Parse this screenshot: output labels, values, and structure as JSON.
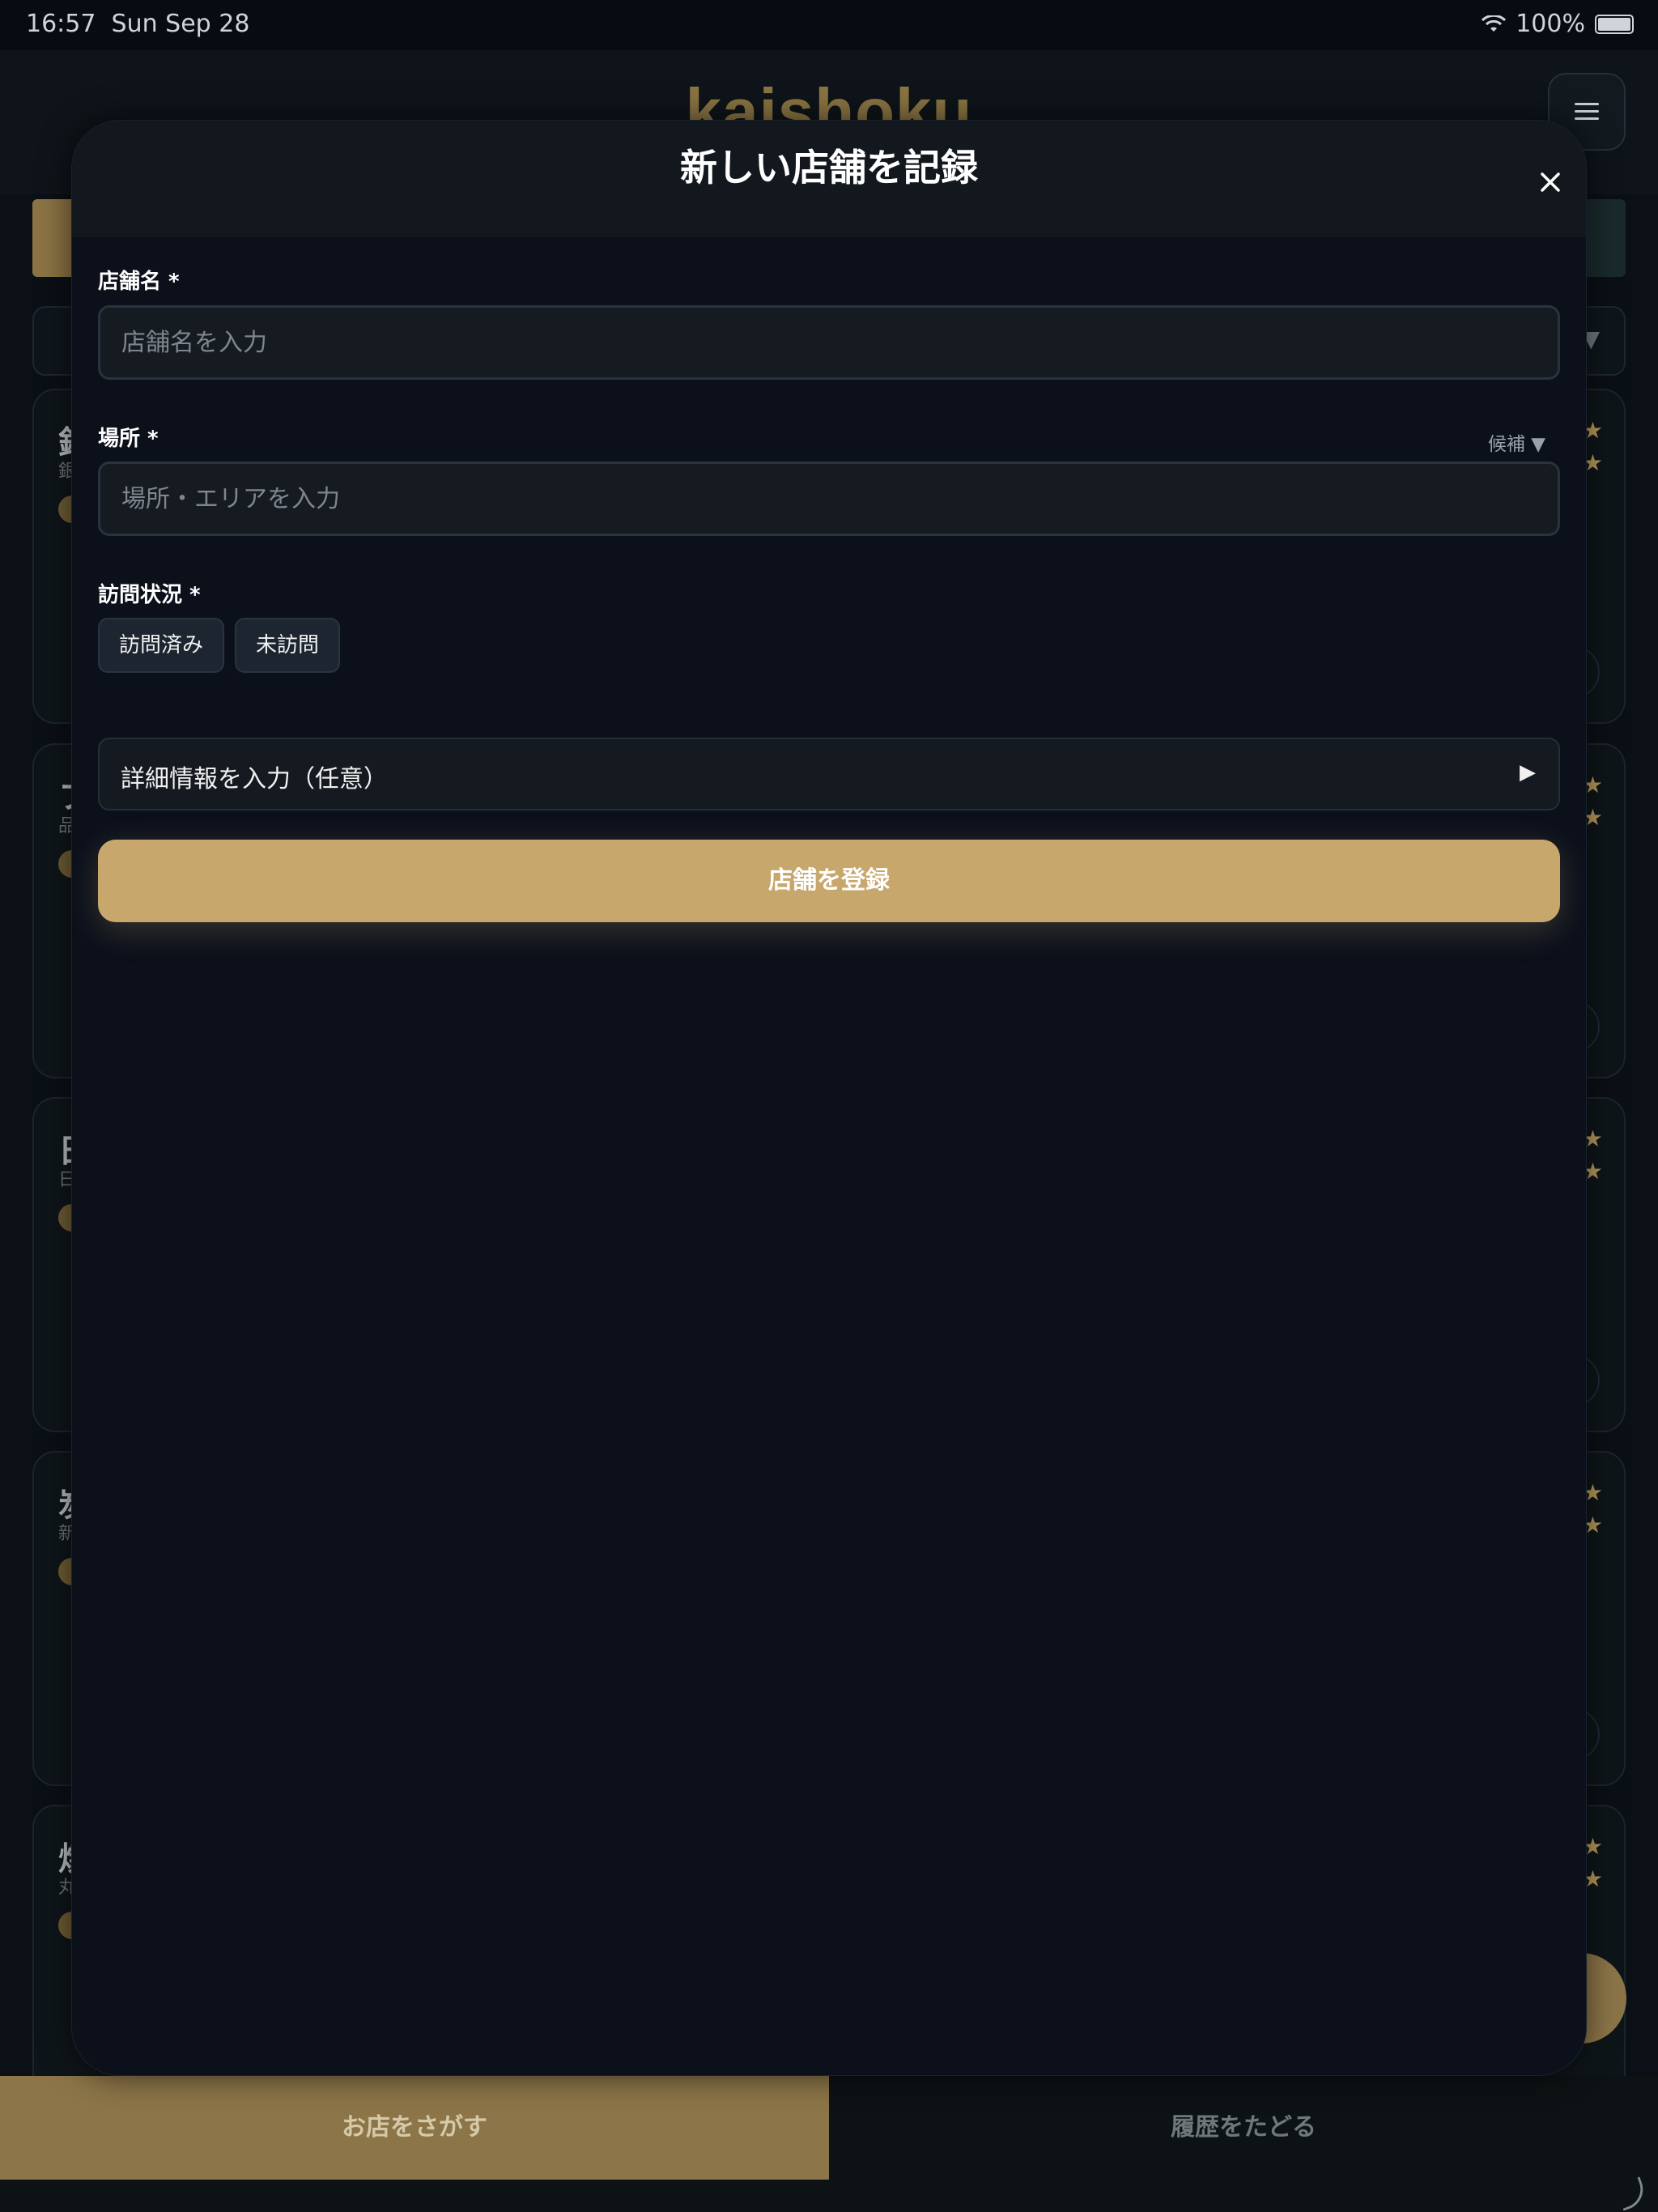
{
  "status_bar": {
    "time": "16:57",
    "date": "Sun Sep 28",
    "battery": "100%"
  },
  "app": {
    "brand": "kaishoku"
  },
  "background_cards": [
    {
      "title": "銀",
      "sub": "銀"
    },
    {
      "title": "フ",
      "sub": "品"
    },
    {
      "title": "日",
      "sub": "日"
    },
    {
      "title": "炭",
      "sub": "新"
    },
    {
      "title": "焼",
      "sub": "丸"
    }
  ],
  "bottom_nav": {
    "search_label": "お店をさがす",
    "history_label": "履歴をたどる"
  },
  "modal": {
    "title": "新しい店舗を記録",
    "store_name": {
      "label": "店舗名 *",
      "placeholder": "店舗名を入力",
      "value": ""
    },
    "location": {
      "label": "場所 *",
      "hint": "候補 ▼",
      "placeholder": "場所・エリアを入力",
      "value": ""
    },
    "visit_status": {
      "label": "訪問状況 *",
      "options": [
        "訪問済み",
        "未訪問"
      ]
    },
    "details_toggle": {
      "label": "詳細情報を入力（任意）",
      "arrow": "▶"
    },
    "submit_label": "店舗を登録"
  },
  "colors": {
    "accent": "#c8a76d",
    "background": "#0b101b",
    "brand_dim": "#8a7442"
  }
}
